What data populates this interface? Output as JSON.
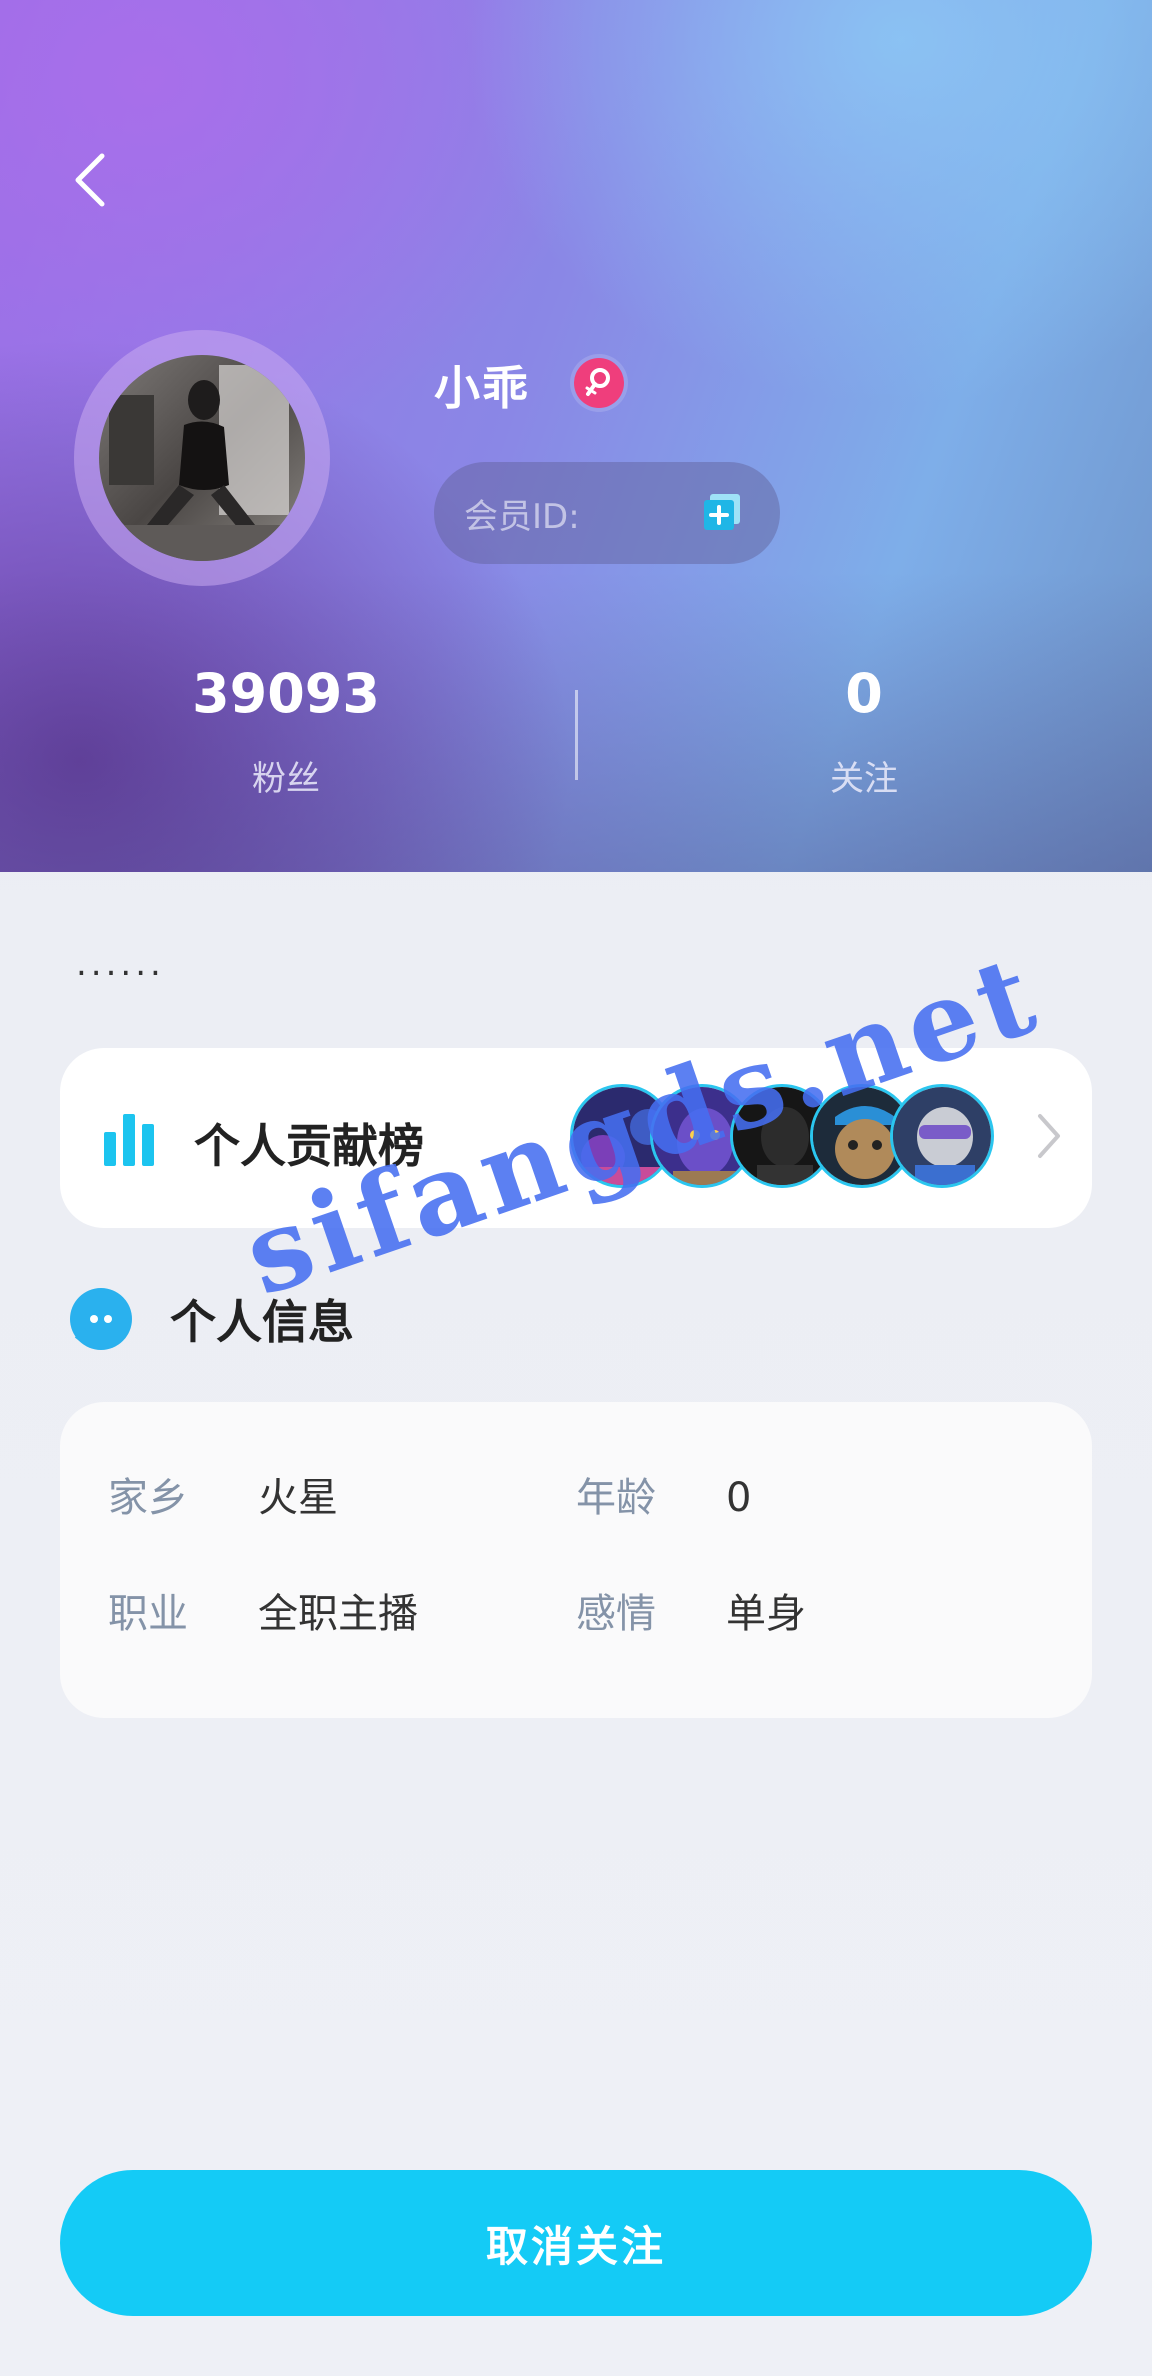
{
  "profile": {
    "nickname": "小乖",
    "gender": "female",
    "member_id_label": "会员ID:",
    "signature": "......"
  },
  "stats": {
    "fans_count": "39093",
    "fans_label": "粉丝",
    "following_count": "0",
    "following_label": "关注"
  },
  "contribution": {
    "title": "个人贡献榜",
    "avatar_count": 5
  },
  "personal_info": {
    "title": "个人信息",
    "rows": [
      [
        {
          "key": "家乡",
          "value": "火星"
        },
        {
          "key": "年龄",
          "value": "0"
        }
      ],
      [
        {
          "key": "职业",
          "value": "全职主播"
        },
        {
          "key": "感情",
          "value": "单身"
        }
      ]
    ]
  },
  "actions": {
    "unfollow_label": "取消关注"
  },
  "watermark": "sifangds.net",
  "colors": {
    "accent": "#14cbf6",
    "gender_badge": "#ef3e7c",
    "info_icon": "#2ab1ee",
    "info_key": "#8493a8",
    "watermark": "#466ef0"
  },
  "icons": {
    "back": "chevron-left-icon",
    "gender": "female-icon",
    "copy": "copy-icon",
    "rank": "bar-chart-icon",
    "rank_more": "chevron-right-icon",
    "info": "chat-bubble-icon"
  }
}
